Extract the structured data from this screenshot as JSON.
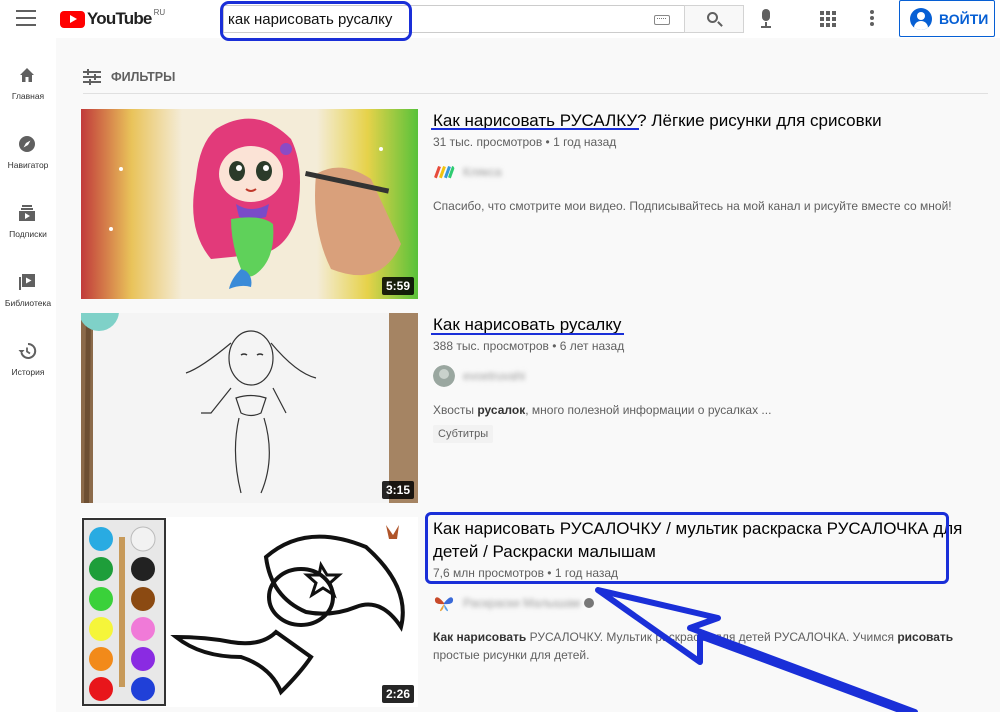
{
  "header": {
    "logo_text": "YouTube",
    "logo_region": "RU",
    "search_query": "как нарисовать русалку",
    "signin_label": "ВОЙТИ"
  },
  "sidebar": {
    "items": [
      {
        "label": "Главная",
        "icon": "home-icon"
      },
      {
        "label": "Навигатор",
        "icon": "compass-icon"
      },
      {
        "label": "Подписки",
        "icon": "subscriptions-icon"
      },
      {
        "label": "Библиотека",
        "icon": "library-icon"
      },
      {
        "label": "История",
        "icon": "history-icon"
      }
    ]
  },
  "filters": {
    "label": "ФИЛЬТРЫ"
  },
  "results": [
    {
      "title": "Как нарисовать РУСАЛКУ? Лёгкие рисунки для срисовки",
      "meta": "31 тыс. просмотров • 1 год назад",
      "channel": "Клякса",
      "description": "Спасибо, что смотрите мои видео. Подписывайтесь на мой канал и рисуйте вместе со мной!",
      "duration": "5:59"
    },
    {
      "title": "Как нарисовать русалку",
      "meta": "388 тыс. просмотров • 6 лет назад",
      "channel": "evoetruvahi",
      "description_pre": "Хвосты ",
      "description_bold": "русалок",
      "description_post": ", много полезной информации о русалках ...",
      "badge": "Субтитры",
      "duration": "3:15"
    },
    {
      "title": "Как нарисовать РУСАЛОЧКУ / мультик раскраска РУСАЛОЧКА для детей / Раскраски малышам",
      "meta": "7,6 млн просмотров • 1 год назад",
      "channel": "Раскраски Малышам",
      "description_bold1": "Как нарисовать",
      "description_mid": " РУСАЛОЧКУ. Мультик раскраска для детей РУСАЛОЧКА. Учимся ",
      "description_bold2": "рисовать",
      "description_post": " простые рисунки для детей.",
      "duration": "2:26"
    }
  ],
  "colors": {
    "annotation_blue": "#1a2fd8",
    "brand_red": "#ff0000",
    "link_blue": "#065fd4"
  }
}
